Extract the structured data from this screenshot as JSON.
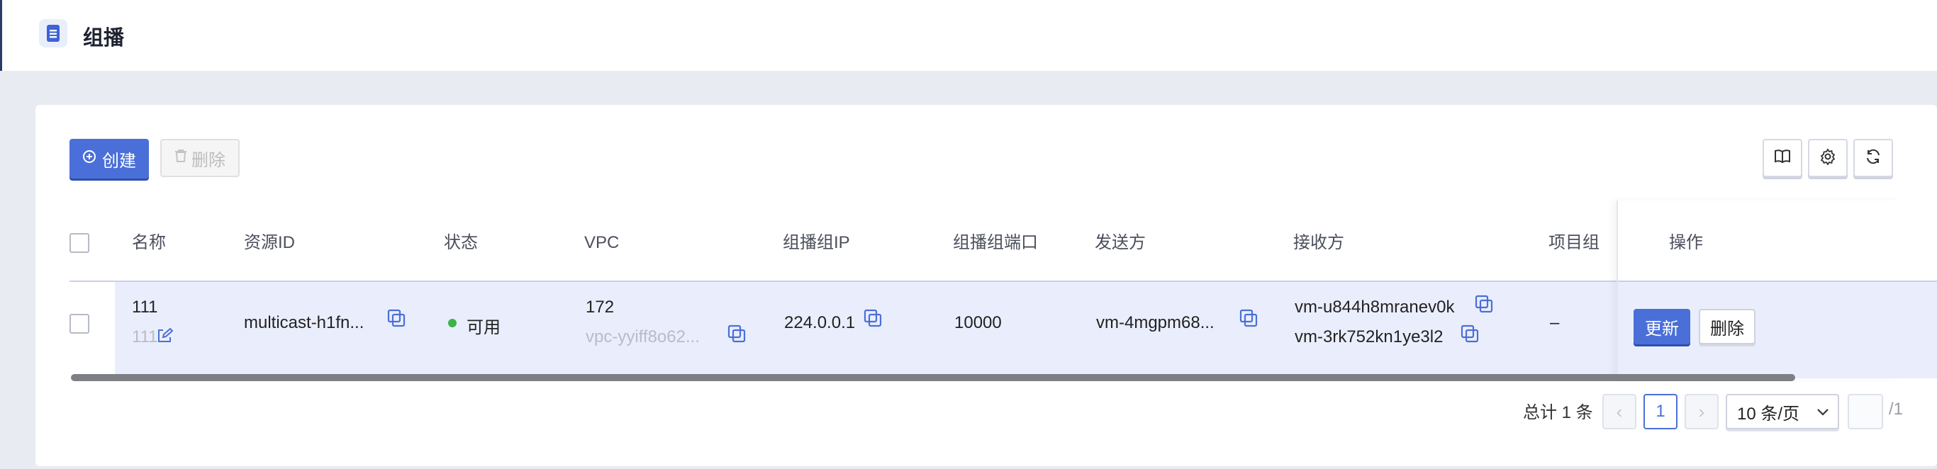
{
  "page": {
    "title": "组播"
  },
  "toolbar": {
    "create_label": "创建",
    "delete_label": "删除"
  },
  "table": {
    "columns": [
      "名称",
      "资源ID",
      "状态",
      "VPC",
      "组播组IP",
      "组播组端口",
      "发送方",
      "接收方",
      "项目组",
      "操作"
    ],
    "rows": [
      {
        "name": "111",
        "name_sub": "111",
        "resource_id": "multicast-h1fn...",
        "status": "可用",
        "status_color": "#3bb54a",
        "vpc": "172",
        "vpc_id": "vpc-yyiff8o62...",
        "group_ip": "224.0.0.1",
        "group_port": "10000",
        "sender": "vm-4mgpm68...",
        "receivers": [
          "vm-u844h8mranev0k",
          "vm-3rk752kn1ye3l2"
        ],
        "project": "–",
        "update_label": "更新",
        "delete_label": "删除"
      }
    ]
  },
  "pagination": {
    "total_text": "总计 1 条",
    "prev": "‹",
    "current": "1",
    "next": "›",
    "page_size": "10 条/页",
    "total_pages": "/1"
  },
  "colors": {
    "accent": "#4a6fd8",
    "row_highlight": "#eaeefc"
  },
  "icons": [
    "file-list-icon",
    "plus-circle-icon",
    "trash-icon",
    "book-icon",
    "gear-icon",
    "refresh-icon",
    "copy-icon",
    "edit-icon",
    "chevron-down-icon"
  ]
}
